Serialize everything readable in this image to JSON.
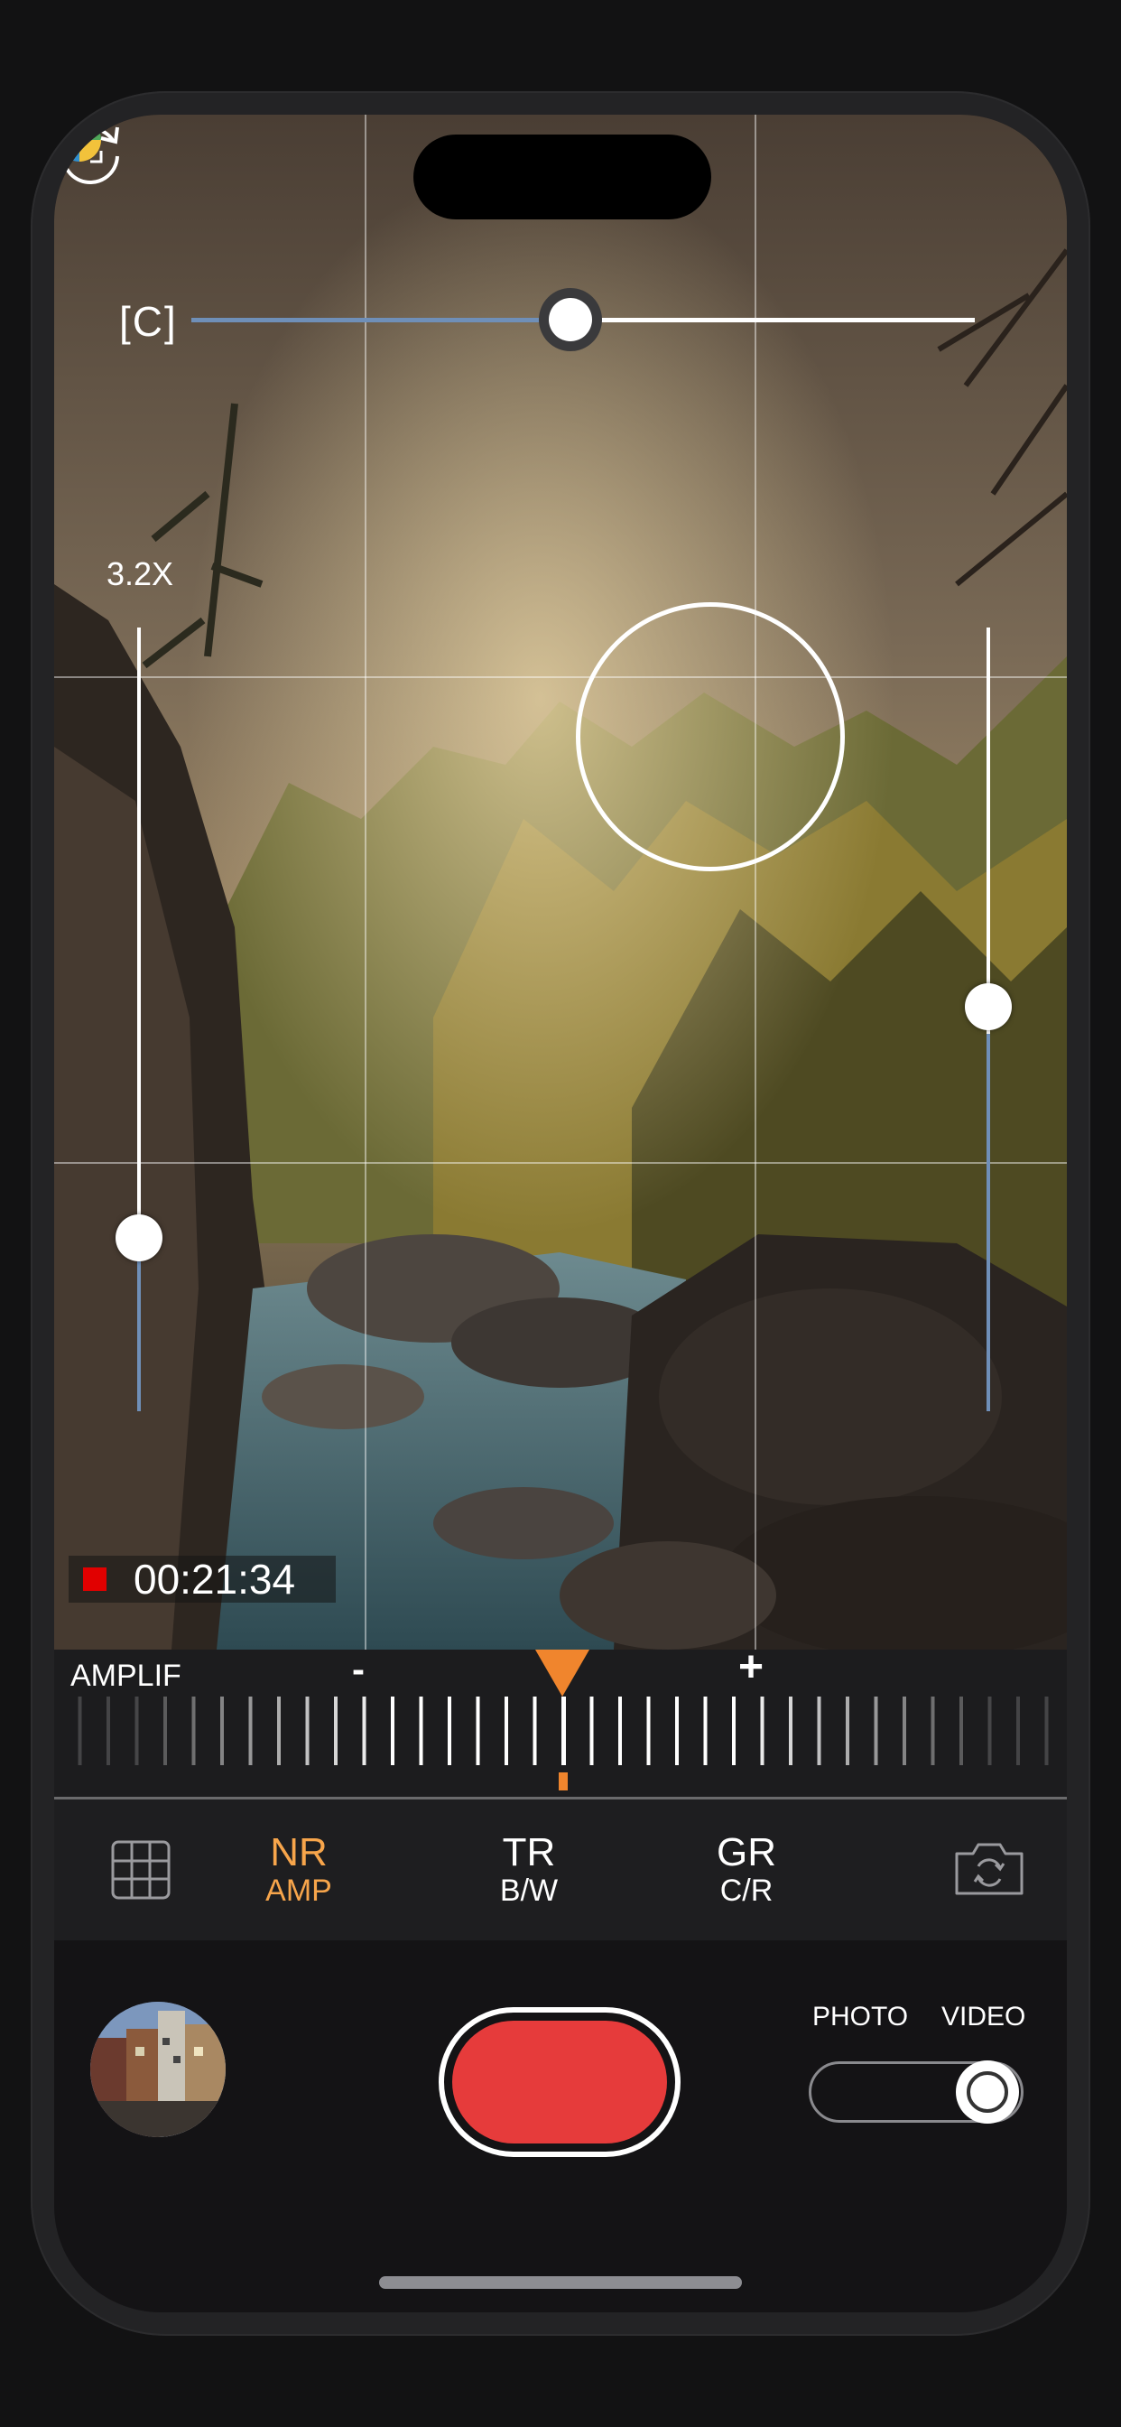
{
  "viewfinder": {
    "top_slider_label": "[C]",
    "top_slider_value": 0.49,
    "zoom_label": "3.2X",
    "zoom_slider_value": 0.22,
    "right_slider_value": 0.48,
    "rec_time": "00:21:34"
  },
  "amplifier": {
    "label": "AMPLIF",
    "minus_label": "-",
    "plus_label": "+"
  },
  "modes": [
    {
      "big": "NR",
      "small": "AMP",
      "active": true
    },
    {
      "big": "TR",
      "small": "B/W",
      "active": false
    },
    {
      "big": "GR",
      "small": "C/R",
      "active": false
    }
  ],
  "capture": {
    "photo_label": "PHOTO",
    "video_label": "VIDEO",
    "selected": "VIDEO"
  },
  "colors": {
    "accent": "#f7a54b",
    "record": "#e63b3b",
    "slider_fill": "#6f8fb8",
    "pointer": "#f0852d"
  }
}
